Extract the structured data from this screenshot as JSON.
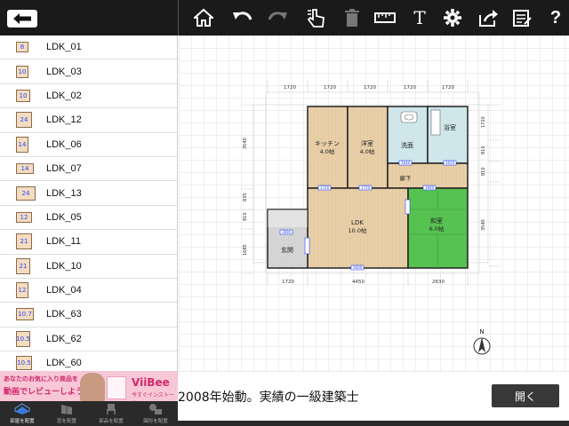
{
  "toolbar": {
    "back_icon": "back-arrow-icon",
    "tools": [
      "home-icon",
      "undo-icon",
      "redo-icon",
      "hand-touch-icon",
      "trash-icon",
      "measure-icon",
      "text-icon",
      "gear-icon",
      "share-icon",
      "note-icon",
      "help-icon"
    ],
    "text_tool_label": "T",
    "help_label": "?"
  },
  "sidebar": {
    "items": [
      {
        "thumb": "8",
        "label": "LDK_01"
      },
      {
        "thumb": "10",
        "label": "LDK_03"
      },
      {
        "thumb": "10",
        "label": "LDK_02"
      },
      {
        "thumb": "24",
        "label": "LDK_12"
      },
      {
        "thumb": "14",
        "label": "LDK_06"
      },
      {
        "thumb": "14",
        "label": "LDK_07"
      },
      {
        "thumb": "24",
        "label": "LDK_13"
      },
      {
        "thumb": "12",
        "label": "LDK_05"
      },
      {
        "thumb": "21",
        "label": "LDK_11"
      },
      {
        "thumb": "21",
        "label": "LDK_10"
      },
      {
        "thumb": "12",
        "label": "LDK_04"
      },
      {
        "thumb": "10.7",
        "label": "LDK_63"
      },
      {
        "thumb": "10.5",
        "label": "LDK_62"
      },
      {
        "thumb": "10.5",
        "label": "LDK_60"
      }
    ]
  },
  "tabs": [
    {
      "label": "部屋を配置",
      "active": true
    },
    {
      "label": "窓を配置",
      "active": false
    },
    {
      "label": "部品を配置",
      "active": false
    },
    {
      "label": "図形を配置",
      "active": false
    }
  ],
  "ad": {
    "line1": "あなたのお気に入り商品を",
    "line2": "動画でレビューしよう!",
    "brand": "ViiBee",
    "sub": "今すぐインストール▶",
    "headline": "2008年始動。実績の一級建築士",
    "open_label": "開く"
  },
  "plan": {
    "dims_top": [
      "1720",
      "1720",
      "1720",
      "1720",
      "1720"
    ],
    "dims_bottom": [
      "1720",
      "4450",
      "2630"
    ],
    "dims_left": [
      "3540",
      "835",
      "810",
      "1685"
    ],
    "dims_right": [
      "1720",
      "810",
      "810",
      "3540"
    ],
    "rooms": {
      "kitchen": {
        "name": "キッチン",
        "size": "4.0帖"
      },
      "western": {
        "name": "洋室",
        "size": "4.0帖"
      },
      "washroom": {
        "name": "洗面"
      },
      "bath": {
        "name": "浴室"
      },
      "hallway": {
        "name": "廊下"
      },
      "ldk": {
        "name": "LDK",
        "size": "10.0帖"
      },
      "japanese": {
        "name": "和室",
        "size": "6.0帖"
      },
      "entrance": {
        "name": "玄関"
      }
    },
    "door_labels": [
      "1720",
      "1720",
      "1640",
      "1620",
      "1840",
      "1694",
      "3600"
    ],
    "compass": "N"
  },
  "colors": {
    "wood": "#e8cfa8",
    "tatami": "#56c250",
    "tile": "#cfe6ea",
    "entrance": "#d8d8d8"
  }
}
